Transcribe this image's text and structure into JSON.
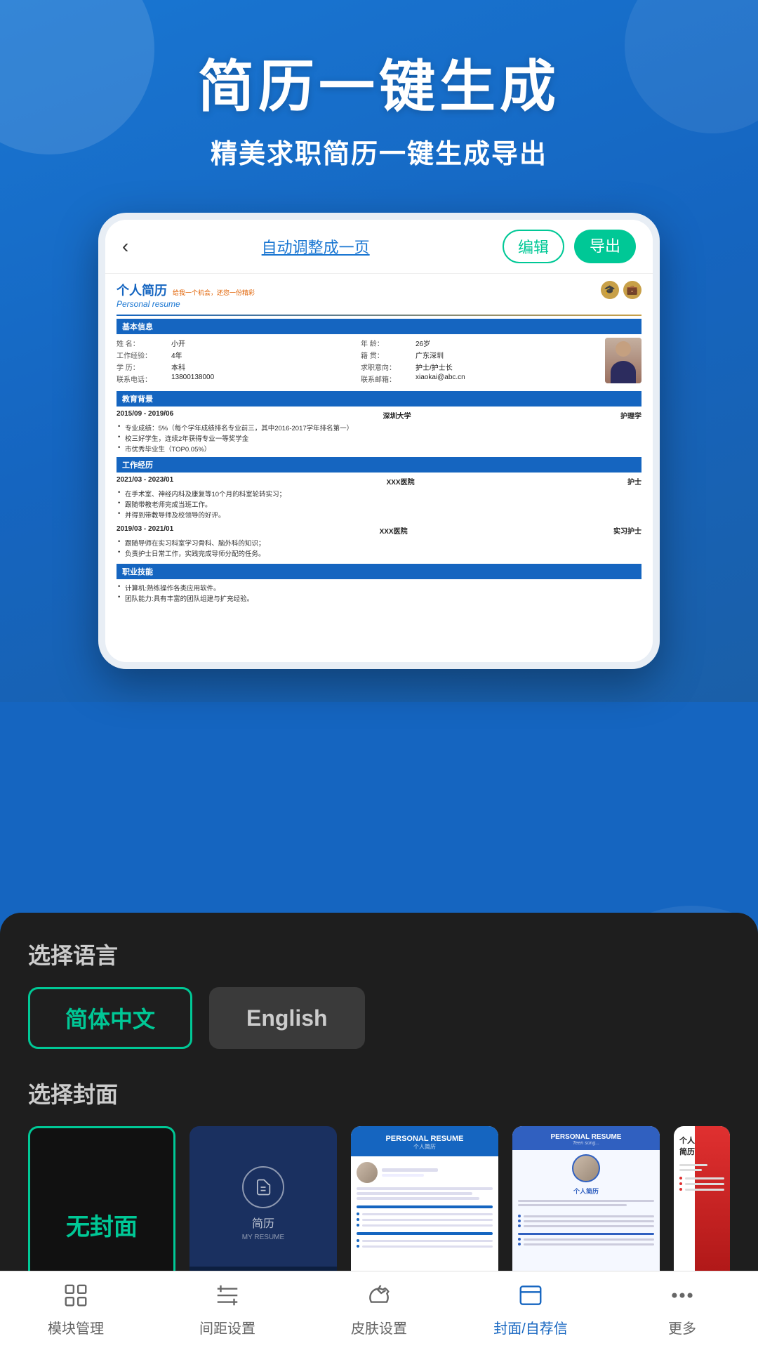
{
  "header": {
    "title": "简历一键生成",
    "subtitle": "精美求职简历一键生成导出"
  },
  "phone": {
    "back_btn": "‹",
    "auto_adjust": "自动调整成一页",
    "edit_btn": "编辑",
    "export_btn": "导出",
    "resume": {
      "title_main": "个人简历",
      "title_tagline": "给我一个机会，还您一份精彩",
      "title_en": "Personal resume",
      "basic_info_title": "基本信息",
      "fields": [
        {
          "label": "姓    名：",
          "value": "小开"
        },
        {
          "label": "工作经验：",
          "value": "4年"
        },
        {
          "label": "学    历：",
          "value": "本科"
        },
        {
          "label": "联系电话：",
          "value": "13800138000"
        },
        {
          "label": "年    龄：",
          "value": "26岁"
        },
        {
          "label": "籍    贯：",
          "value": "广东深圳"
        },
        {
          "label": "求职意向：",
          "value": "护士/护士长"
        },
        {
          "label": "联系邮箱：",
          "value": "xiaokai@abc.cn"
        }
      ],
      "edu_title": "教育背景",
      "edu_period": "2015/09 - 2019/06",
      "edu_school": "深圳大学",
      "edu_major": "护理学",
      "edu_bullets": [
        "专业成绩：5%（每个学年成绩排名专业前三，其中2016-2017学年排名第一）",
        "校三好学生，连续2年获得专业一等奖学金",
        "市优秀毕业生（TOP0.05%）"
      ],
      "work_title": "工作经历",
      "work1_period": "2021/03 - 2023/01",
      "work1_company": "XXX医院",
      "work1_position": "护士",
      "work1_bullets": [
        "在手术室、神经内科及康复等10个月的科室轮转实习；",
        "跟随带教老师完成当班工作。",
        "并得到带教导师及校领导的好评。"
      ],
      "work2_period": "2019/03 - 2021/01",
      "work2_company": "XXX医院",
      "work2_position": "实习护士",
      "work2_bullets": [
        "跟随导师在实习科室学习骨科、脑外科的知识；",
        "负责护士日常工作，实践完成导师分配的任务。"
      ],
      "skills_title": "职业技能",
      "skills_bullets": [
        "计算机:熟练操作各类应用软件。",
        "团队能力:具有丰富的团队组建与扩充经验。"
      ]
    }
  },
  "bottom_panel": {
    "lang_title": "选择语言",
    "lang_options": [
      {
        "label": "简体中文",
        "active": true
      },
      {
        "label": "English",
        "active": false
      }
    ],
    "cover_title": "选择封面",
    "covers": [
      {
        "id": "none",
        "label": "无封面",
        "active": true
      },
      {
        "id": "dark",
        "label": "简历",
        "sublabel": "MY RESUME",
        "active": false
      },
      {
        "id": "light",
        "label": "个人简历",
        "sublabel": "PERSONAL RESUME",
        "active": false
      },
      {
        "id": "light2",
        "label": "个人简历",
        "sublabel": "PERSONAL RESUME",
        "active": false
      },
      {
        "id": "red",
        "label": "",
        "active": false
      }
    ]
  },
  "nav": {
    "items": [
      {
        "icon": "⊞",
        "label": "模块管理",
        "active": false
      },
      {
        "icon": "≡",
        "label": "间距设置",
        "active": false
      },
      {
        "icon": "👕",
        "label": "皮肤设置",
        "active": false
      },
      {
        "icon": "▭",
        "label": "封面/自荐信",
        "active": false
      },
      {
        "icon": "···",
        "label": "更多",
        "active": false
      }
    ]
  }
}
